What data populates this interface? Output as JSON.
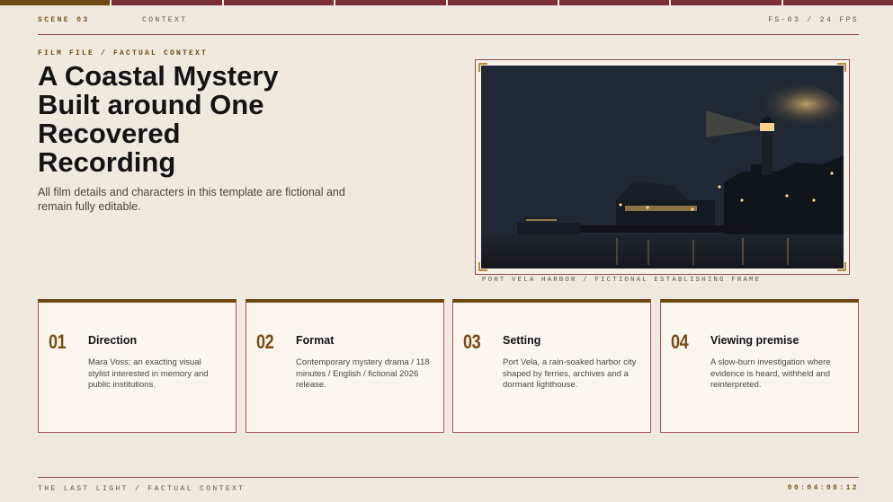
{
  "progress": {
    "segments": 8,
    "active_index": 0
  },
  "topbar": {
    "scene": "SCENE 03",
    "context": "CONTEXT",
    "fps": "FS-03 / 24 FPS"
  },
  "eyebrow": "FILM FILE / FACTUAL CONTEXT",
  "title_lines": [
    "A Coastal Mystery",
    "Built around One",
    "Recovered",
    "Recording"
  ],
  "subtitle": "All film details and characters in this template are fictional and remain fully editable.",
  "image": {
    "caption": "PORT VELA HARBOR / FICTIONAL ESTABLISHING FRAME"
  },
  "cards": [
    {
      "number": "01",
      "heading": "Direction",
      "body": "Mara Voss; an exacting visual stylist interested in memory and public institutions."
    },
    {
      "number": "02",
      "heading": "Format",
      "body": "Contemporary mystery drama / 118 minutes / English / fictional 2026 release."
    },
    {
      "number": "03",
      "heading": "Setting",
      "body": "Port Vela, a rain-soaked harbor city shaped by ferries, archives and a dormant lighthouse."
    },
    {
      "number": "04",
      "heading": "Viewing premise",
      "body": "A slow-burn investigation where evidence is heard, withheld and reinterpreted."
    }
  ],
  "footer": {
    "left": "THE LAST LIGHT / FACTUAL CONTEXT",
    "timecode": "00:04:08:12"
  },
  "colors": {
    "background": "#efe9df",
    "accent_gold": "#6e4a12",
    "accent_wine": "#7a2f35",
    "card_bg": "#fbf7f0"
  }
}
